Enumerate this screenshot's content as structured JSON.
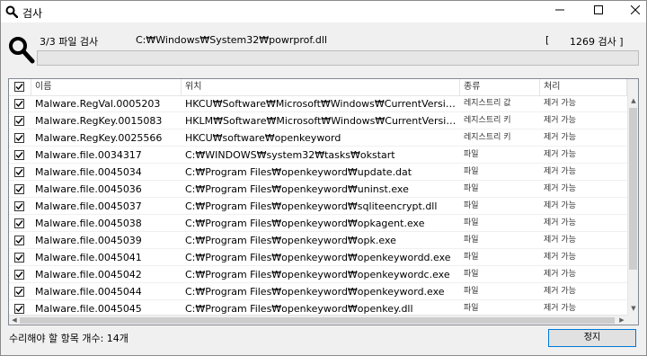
{
  "window": {
    "title": "검사",
    "minimize_icon": "minimize-icon",
    "maximize_icon": "maximize-icon",
    "close_icon": "close-icon"
  },
  "scan": {
    "progress_label": "3/3 파일 검사",
    "current_path": "C:₩Windows₩System32₩powrprof.dll",
    "count_open": "[",
    "count_text": "1269 검사 ]",
    "progress_fraction": 0.0,
    "icon": "magnifier-icon"
  },
  "list": {
    "columns": [
      "이름",
      "위치",
      "종류",
      "처리"
    ],
    "rows": [
      {
        "checked": true,
        "name": "Malware.RegVal.0005203",
        "location": "HKCU₩Software₩Microsoft₩Windows₩CurrentVersion₩run ,\"openk...",
        "type": "레지스트리 값",
        "action": "제거 가능"
      },
      {
        "checked": true,
        "name": "Malware.RegKey.0015083",
        "location": "HKLM₩Software₩Microsoft₩Windows₩CurrentVersion₩uninstall₩op...",
        "type": "레지스트리 키",
        "action": "제거 가능"
      },
      {
        "checked": true,
        "name": "Malware.RegKey.0025566",
        "location": "HKCU₩software₩openkeyword",
        "type": "레지스트리 키",
        "action": "제거 가능"
      },
      {
        "checked": true,
        "name": "Malware.file.0034317",
        "location": "C:₩WINDOWS₩system32₩tasks₩okstart",
        "type": "파일",
        "action": "제거 가능"
      },
      {
        "checked": true,
        "name": "Malware.file.0045034",
        "location": "C:₩Program Files₩openkeyword₩update.dat",
        "type": "파일",
        "action": "제거 가능"
      },
      {
        "checked": true,
        "name": "Malware.file.0045036",
        "location": "C:₩Program Files₩openkeyword₩uninst.exe",
        "type": "파일",
        "action": "제거 가능"
      },
      {
        "checked": true,
        "name": "Malware.file.0045037",
        "location": "C:₩Program Files₩openkeyword₩sqliteencrypt.dll",
        "type": "파일",
        "action": "제거 가능"
      },
      {
        "checked": true,
        "name": "Malware.file.0045038",
        "location": "C:₩Program Files₩openkeyword₩opkagent.exe",
        "type": "파일",
        "action": "제거 가능"
      },
      {
        "checked": true,
        "name": "Malware.file.0045039",
        "location": "C:₩Program Files₩openkeyword₩opk.exe",
        "type": "파일",
        "action": "제거 가능"
      },
      {
        "checked": true,
        "name": "Malware.file.0045041",
        "location": "C:₩Program Files₩openkeyword₩openkeywordd.exe",
        "type": "파일",
        "action": "제거 가능"
      },
      {
        "checked": true,
        "name": "Malware.file.0045042",
        "location": "C:₩Program Files₩openkeyword₩openkeywordc.exe",
        "type": "파일",
        "action": "제거 가능"
      },
      {
        "checked": true,
        "name": "Malware.file.0045044",
        "location": "C:₩Program Files₩openkeyword₩openkeyword.exe",
        "type": "파일",
        "action": "제거 가능"
      },
      {
        "checked": true,
        "name": "Malware.file.0045045",
        "location": "C:₩Program Files₩openkeyword₩openkey.dll",
        "type": "파일",
        "action": "제거 가능"
      }
    ]
  },
  "footer": {
    "status": "수리해야 할 항목 개수: 14개",
    "stop_label": "정지"
  },
  "colors": {
    "accent": "#0078d7",
    "progress": "#06b025"
  }
}
